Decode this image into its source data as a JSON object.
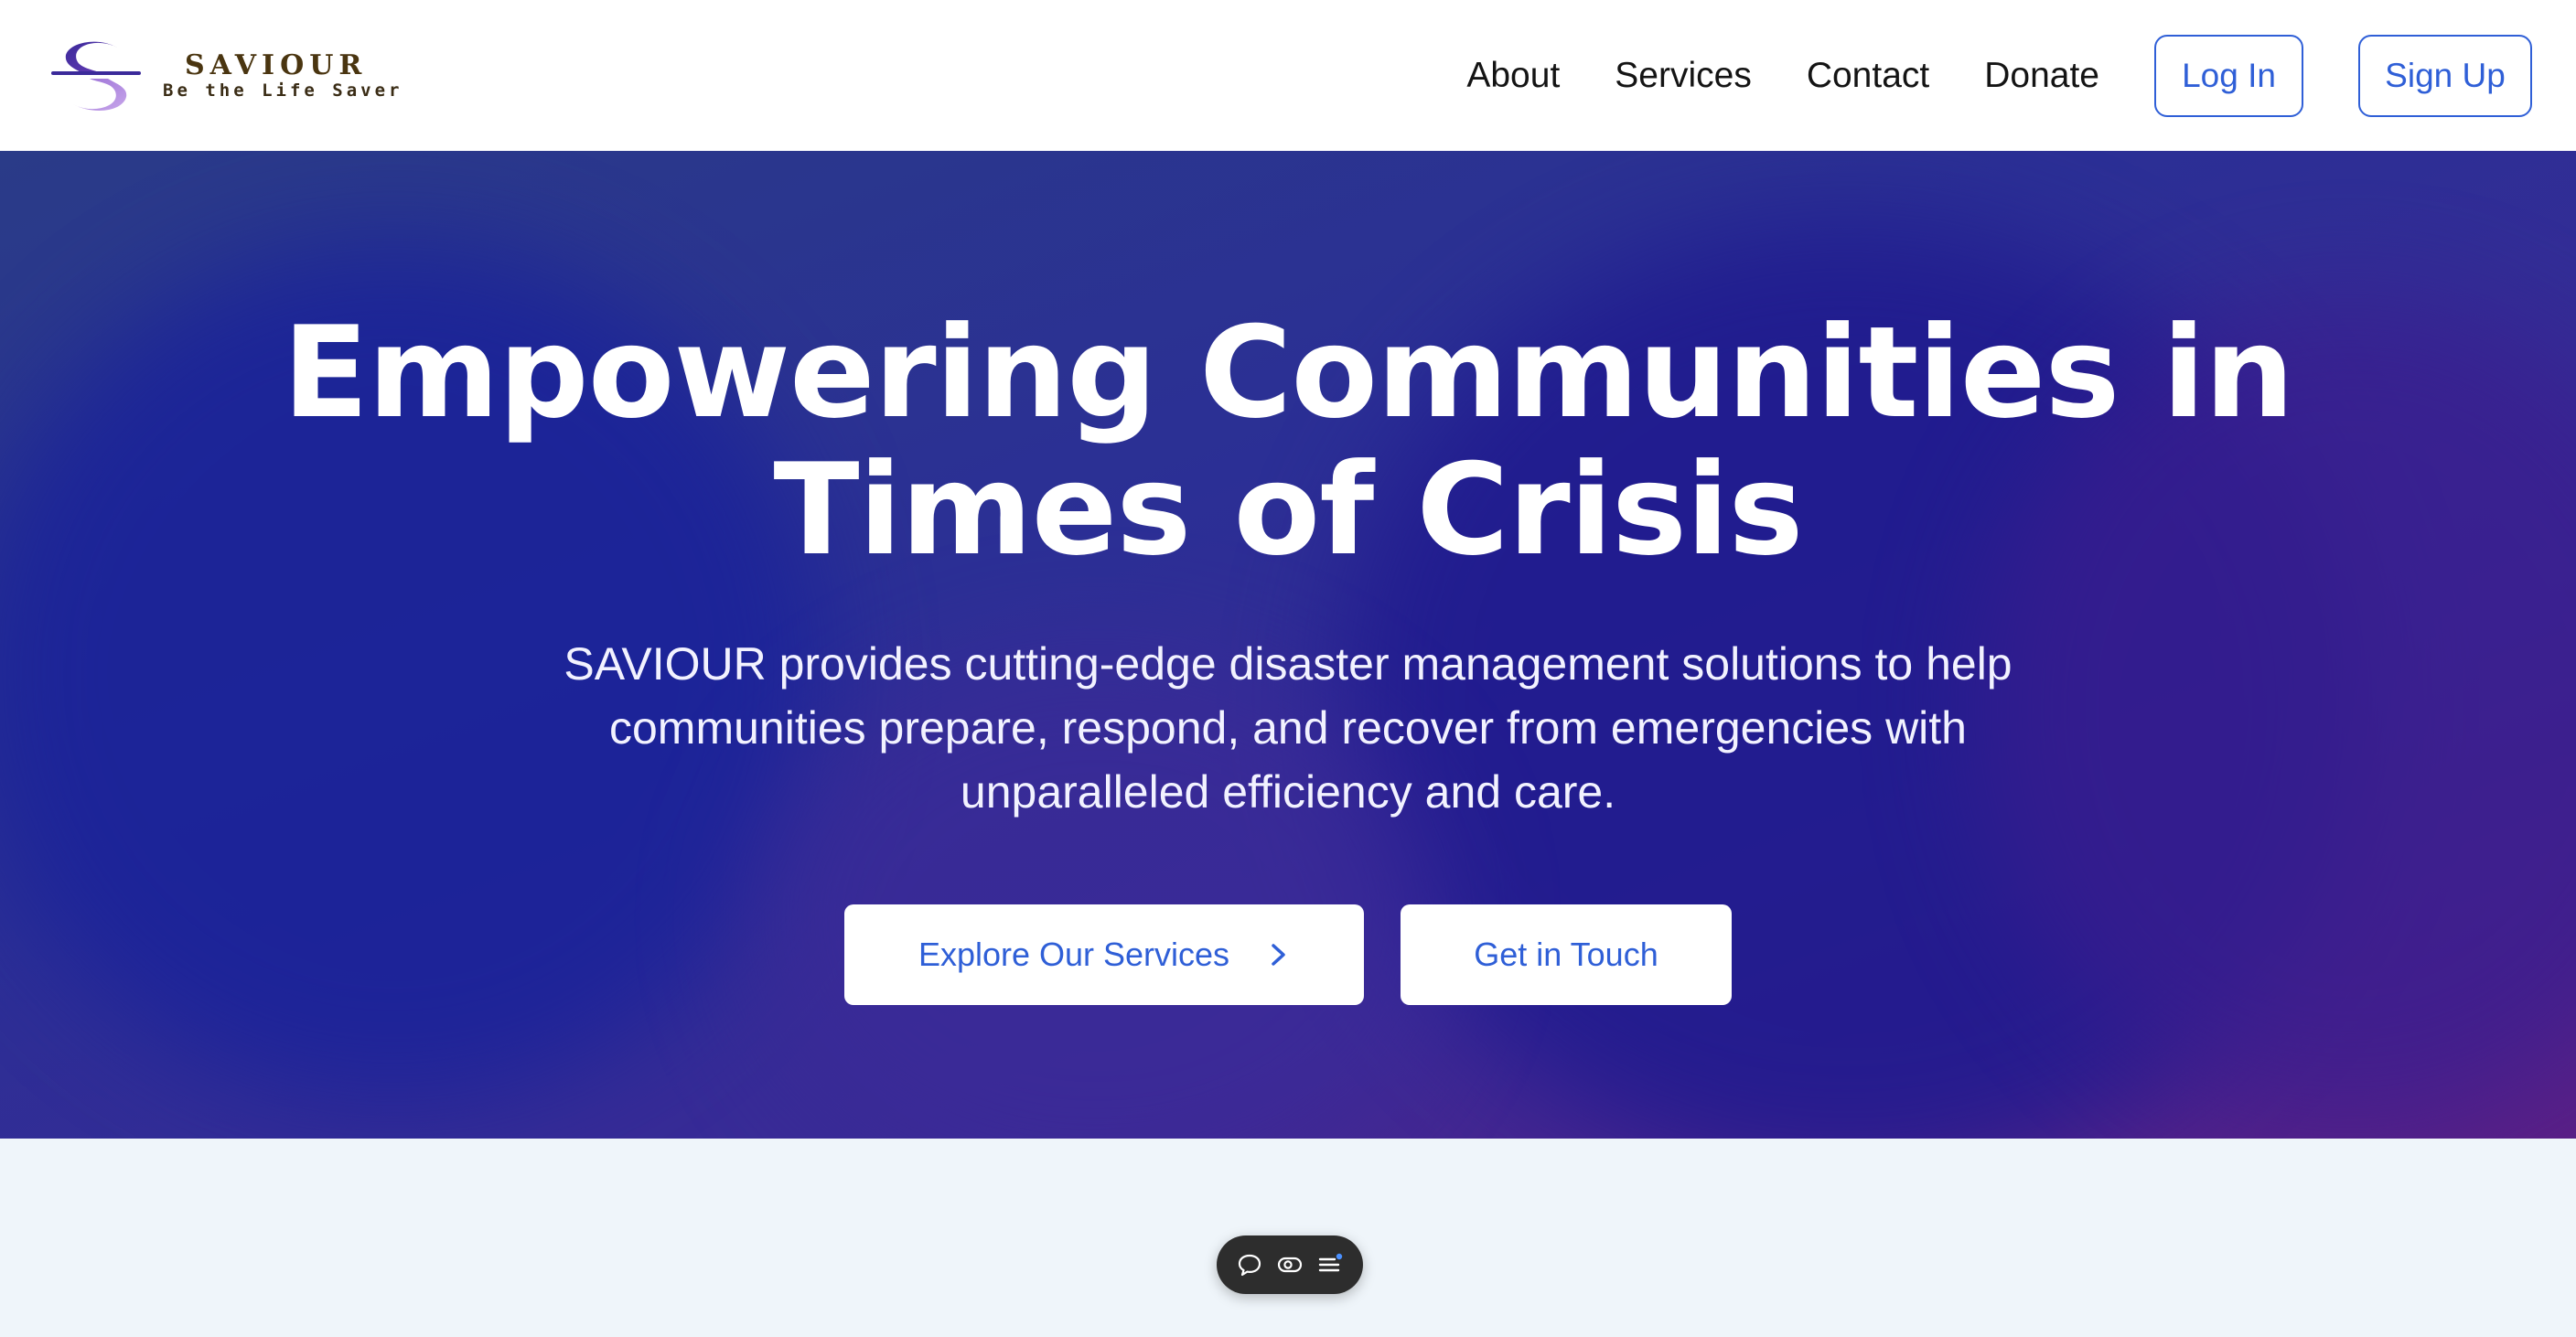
{
  "brand": {
    "name": "SAVIOUR",
    "tagline": "Be the Life Saver",
    "logo_icon": "saviour-s-logo-icon"
  },
  "nav": {
    "links": [
      "About",
      "Services",
      "Contact",
      "Donate"
    ],
    "login_label": "Log In",
    "signup_label": "Sign Up"
  },
  "hero": {
    "title": "Empowering Communities in Times of Crisis",
    "subtitle": "SAVIOUR provides cutting-edge disaster management solutions to help communities prepare, respond, and recover from emergencies with unparalleled efficiency and care.",
    "primary_button": "Explore Our Services",
    "secondary_button": "Get in Touch",
    "primary_button_icon": "chevron-right-icon"
  },
  "floating_toolbar": {
    "icons": [
      "chat-bubble-icon",
      "toggle-icon",
      "menu-list-icon"
    ]
  },
  "colors": {
    "accent": "#2f5fd7",
    "brand_text": "#4a3510",
    "hero_start": "#2a3b88",
    "hero_end": "#5a1f86",
    "lower_bg": "#eff5fa"
  }
}
